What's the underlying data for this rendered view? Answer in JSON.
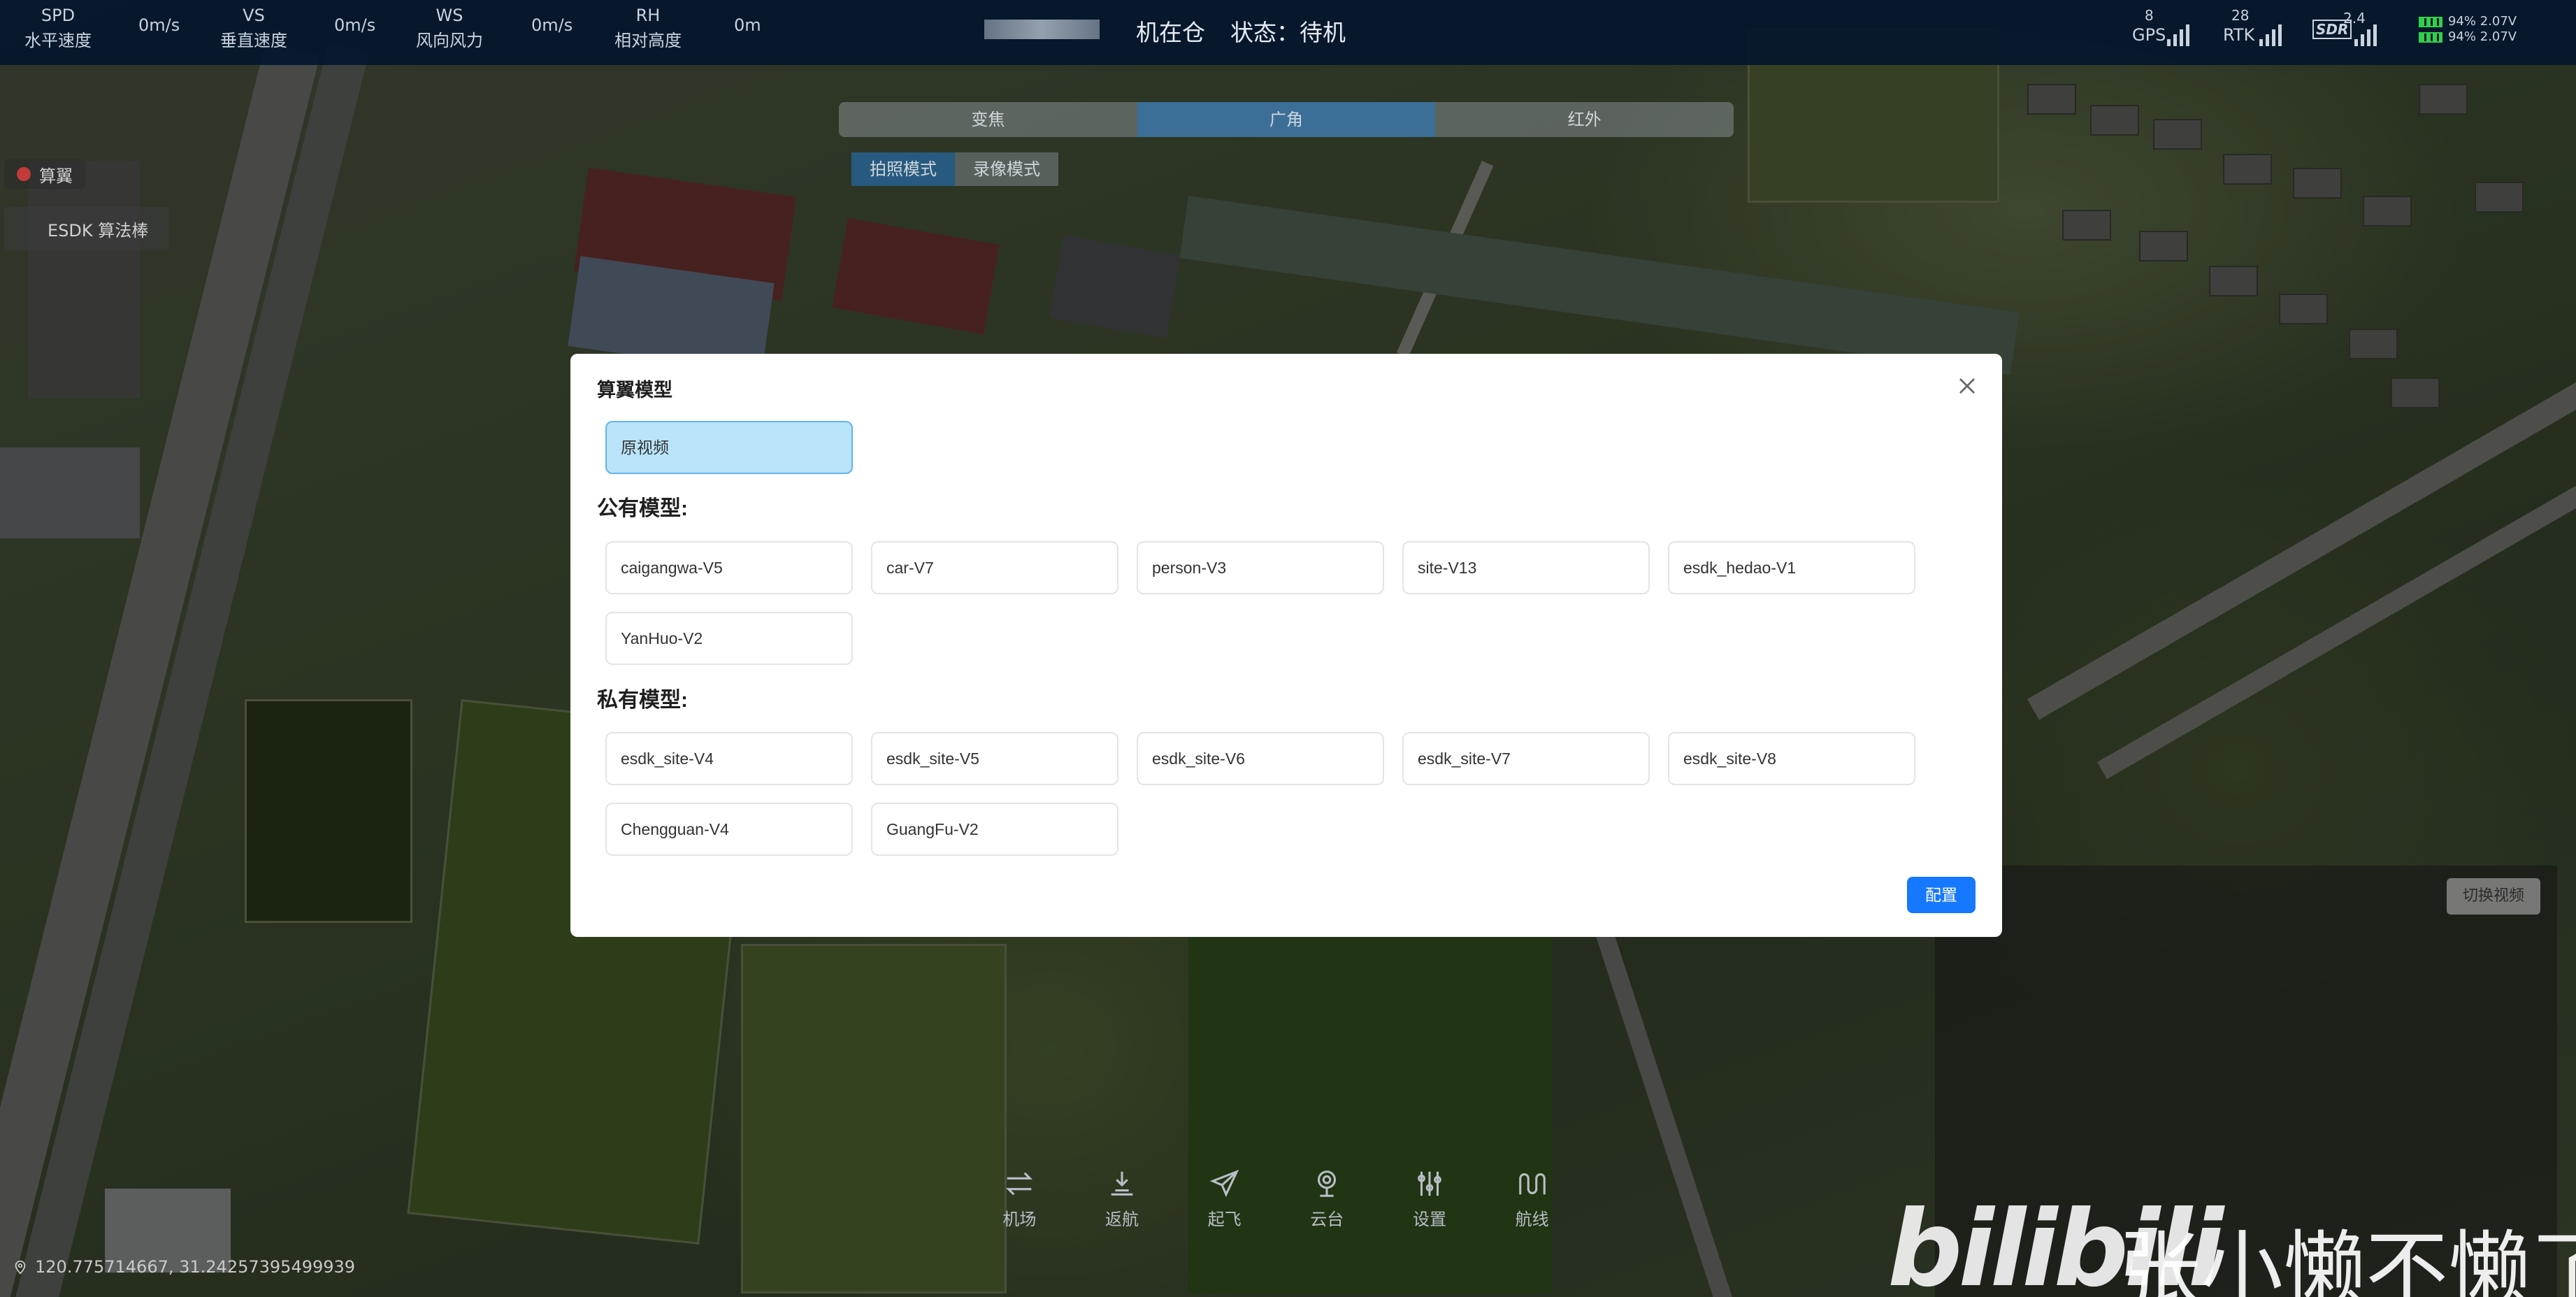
{
  "topbar": {
    "telemetry": [
      {
        "code": "SPD",
        "label": "水平速度",
        "value": "0m/s"
      },
      {
        "code": "VS",
        "label": "垂直速度",
        "value": "0m/s"
      },
      {
        "code": "WS",
        "label": "风向风力",
        "value": "0m/s"
      },
      {
        "code": "RH",
        "label": "相对高度",
        "value": "0m"
      }
    ],
    "dock_status": "机在仓",
    "state": "状态：待机",
    "gps": {
      "count": "8",
      "label": "GPS"
    },
    "rtk": {
      "count": "28",
      "label": "RTK"
    },
    "sdr": {
      "value": "2.4",
      "label": "SDR"
    },
    "battery": [
      "94% 2.07V",
      "94% 2.07V"
    ]
  },
  "sidebar": {
    "item1": "算翼",
    "item2": "ESDK 算法棒"
  },
  "camera_modes": {
    "tabs": [
      "变焦",
      "广角",
      "红外"
    ],
    "active_tab": "广角",
    "shot_modes": [
      "拍照模式",
      "录像模式"
    ]
  },
  "video_panel": {
    "switch_label": "切换视频"
  },
  "dock": {
    "items": [
      {
        "label": "机场",
        "icon": "swap-arrows-icon"
      },
      {
        "label": "返航",
        "icon": "return-home-icon"
      },
      {
        "label": "起飞",
        "icon": "paper-plane-icon"
      },
      {
        "label": "云台",
        "icon": "gimbal-camera-icon"
      },
      {
        "label": "设置",
        "icon": "sliders-icon"
      },
      {
        "label": "航线",
        "icon": "route-wave-icon"
      }
    ]
  },
  "coords": "120.775714667, 31.24257395499939",
  "watermark": {
    "logo": "bilibili",
    "text": "张小懒不懒了"
  },
  "modal": {
    "title": "算翼模型",
    "original_video": "原视频",
    "public_label": "公有模型:",
    "public_models": [
      "caigangwa-V5",
      "car-V7",
      "person-V3",
      "site-V13",
      "esdk_hedao-V1",
      "YanHuo-V2"
    ],
    "private_label": "私有模型:",
    "private_models": [
      "esdk_site-V4",
      "esdk_site-V5",
      "esdk_site-V6",
      "esdk_site-V7",
      "esdk_site-V8",
      "Chengguan-V4",
      "GuangFu-V2"
    ],
    "config_button": "配置"
  }
}
